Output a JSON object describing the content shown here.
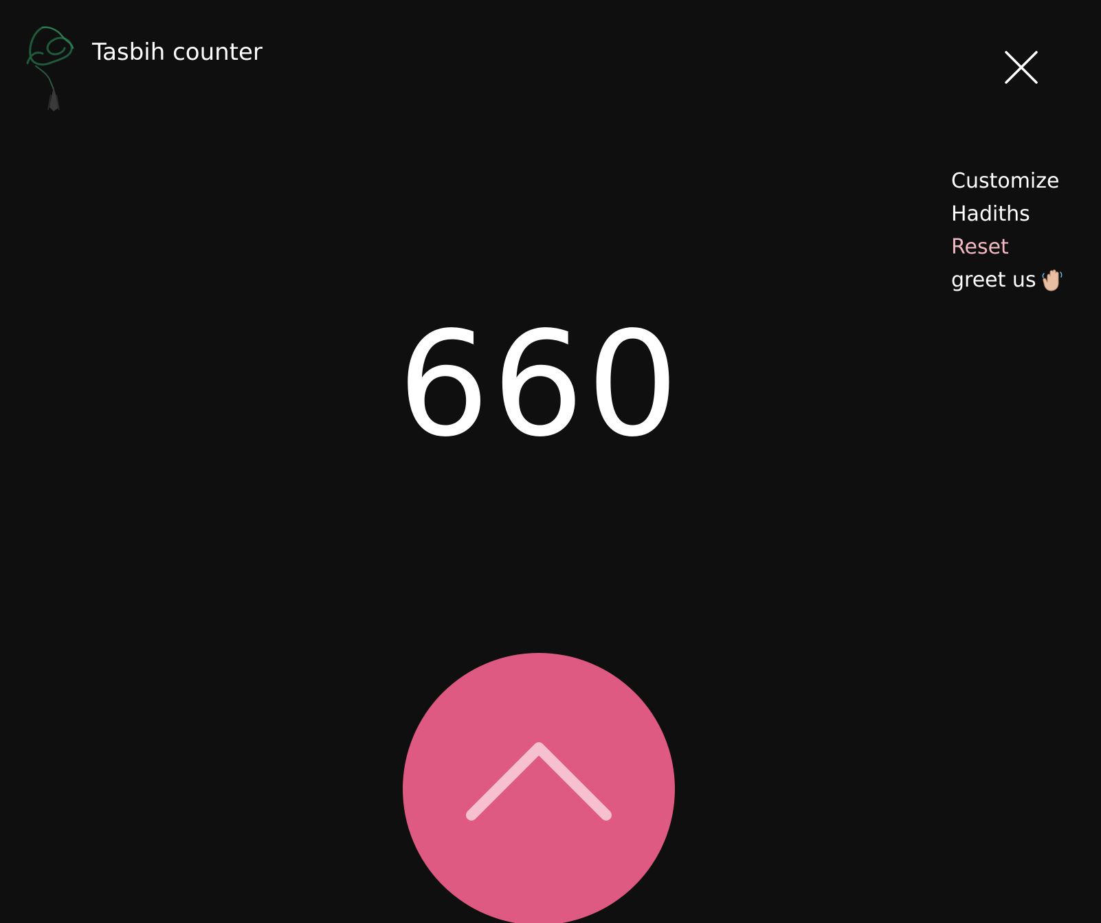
{
  "header": {
    "title": "Tasbih counter",
    "logo_icon": "prayer-beads-icon",
    "close_icon": "close-icon"
  },
  "menu": {
    "items": [
      {
        "label": "Customize",
        "name": "menu-customize"
      },
      {
        "label": "Hadiths",
        "name": "menu-hadiths"
      },
      {
        "label": "Reset",
        "name": "menu-reset",
        "color": "#f2b7c3"
      },
      {
        "label": "greet us",
        "name": "menu-greet-us",
        "icon": "waving-hand-icon"
      }
    ]
  },
  "counter": {
    "value": "660"
  },
  "count_button": {
    "icon": "chevron-up-icon",
    "color": "#df5a83",
    "icon_color": "#f7c0d0"
  },
  "colors": {
    "background": "#0f0f10",
    "text": "#ffffff",
    "accent": "#df5a83",
    "logo": "#1f5a3a"
  }
}
